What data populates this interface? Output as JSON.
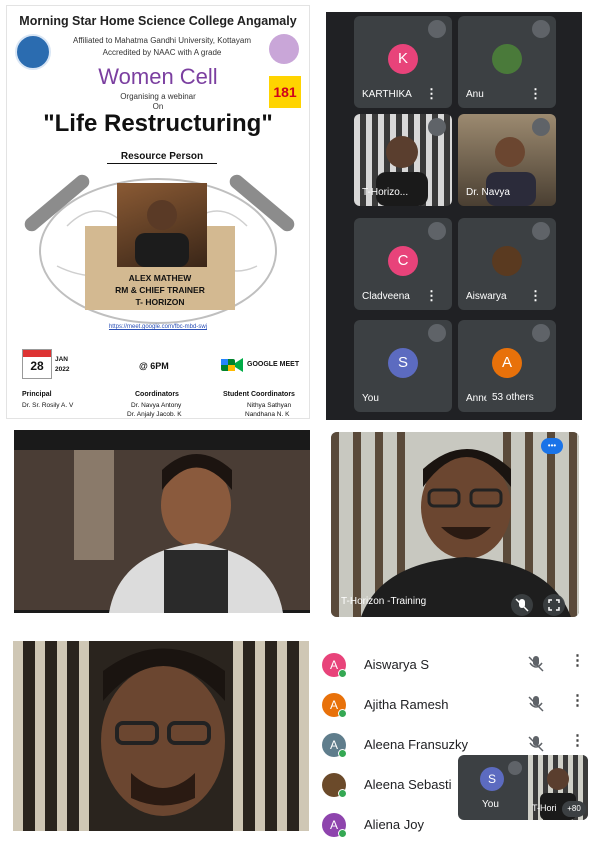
{
  "poster": {
    "college": "Morning Star Home Science College Angamaly",
    "affiliation": "Affiliated to Mahatma Gandhi University, Kottayam",
    "accreditation": "Accredited by NAAC with A grade",
    "cell": "Women Cell",
    "organising": "Organising a webinar",
    "on": "On",
    "webinar_title": "\"Life Restructuring\"",
    "resource_label": "Resource Person",
    "speaker_name": "ALEX MATHEW",
    "speaker_role": "RM & CHIEF TRAINER",
    "speaker_org": "T- HORIZON",
    "meet_link": "https://meet.google.com/fbc-mbd-swj",
    "badge_181": "181",
    "date_day": "28",
    "date_month": "JAN",
    "date_year": "2022",
    "time": "@ 6PM",
    "platform": "GOOGLE MEET",
    "principal_label": "Principal",
    "principal_name": "Dr. Sr. Rosily A. V",
    "coordinators_label": "Coordinators",
    "coordinator_1": "Dr. Navya Antony",
    "coordinator_2": "Dr. Anjaly Jacob. K",
    "student_coordinators_label": "Student Coordinators",
    "student_coordinator_1": "Nithya Sathyan",
    "student_coordinator_2": "Nandhana N. K"
  },
  "meet_grid": {
    "tiles": [
      {
        "name": "KARTHIKA",
        "initial": "K",
        "color": "#e8437a"
      },
      {
        "name": "Anu",
        "initial": "",
        "color": "#4a7a3a"
      },
      {
        "name": "T-Horizo...",
        "initial": "",
        "color": ""
      },
      {
        "name": "Dr. Navya",
        "initial": "",
        "color": ""
      },
      {
        "name": "Cladveena",
        "initial": "C",
        "color": "#e8437a"
      },
      {
        "name": "Aiswarya",
        "initial": "",
        "color": "#5a3a20"
      },
      {
        "name": "You",
        "initial": "S",
        "color": "#5c6bc0"
      },
      {
        "name": "Anne",
        "initial": "A",
        "color": "#e8710a"
      }
    ],
    "others_label": "53 others"
  },
  "video_speaker_label": "T-Horizon -Training",
  "participants": [
    {
      "name": "Aiswarya S",
      "initial": "A",
      "color": "#e8437a"
    },
    {
      "name": "Ajitha Ramesh",
      "initial": "A",
      "color": "#e8710a"
    },
    {
      "name": "Aleena Fransuzky",
      "initial": "A",
      "color": "#5f7d8c"
    },
    {
      "name": "Aleena Sebasti",
      "initial": "",
      "color": "#6b4a2a"
    },
    {
      "name": "Aliena Joy",
      "initial": "A",
      "color": "#8e44ad"
    }
  ],
  "self_view": {
    "initial": "S",
    "label": "You",
    "other_label": "T-Hori",
    "count_badge": "+80"
  }
}
